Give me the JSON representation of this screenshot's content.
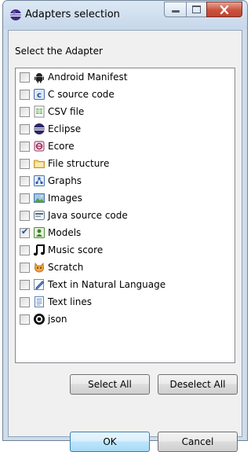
{
  "window": {
    "title": "Adapters selection"
  },
  "dialog": {
    "prompt": "Select the Adapter",
    "items": [
      {
        "label": "Android Manifest",
        "checked": false,
        "icon": "android-icon"
      },
      {
        "label": "C source code",
        "checked": false,
        "icon": "c-file-icon"
      },
      {
        "label": "CSV file",
        "checked": false,
        "icon": "csv-icon"
      },
      {
        "label": "Eclipse",
        "checked": false,
        "icon": "eclipse-icon"
      },
      {
        "label": "Ecore",
        "checked": false,
        "icon": "ecore-icon"
      },
      {
        "label": "File structure",
        "checked": false,
        "icon": "folder-icon"
      },
      {
        "label": "Graphs",
        "checked": false,
        "icon": "graph-icon"
      },
      {
        "label": "Images",
        "checked": false,
        "icon": "image-icon"
      },
      {
        "label": "Java source code",
        "checked": false,
        "icon": "java-icon"
      },
      {
        "label": "Models",
        "checked": true,
        "icon": "model-icon"
      },
      {
        "label": "Music score",
        "checked": false,
        "icon": "music-note-icon"
      },
      {
        "label": "Scratch",
        "checked": false,
        "icon": "scratch-cat-icon"
      },
      {
        "label": "Text in Natural Language",
        "checked": false,
        "icon": "pencil-doc-icon"
      },
      {
        "label": "Text lines",
        "checked": false,
        "icon": "text-doc-icon"
      },
      {
        "label": "json",
        "checked": false,
        "icon": "json-icon"
      }
    ],
    "select_all_label": "Select All",
    "deselect_all_label": "Deselect All",
    "ok_label": "OK",
    "cancel_label": "Cancel"
  }
}
